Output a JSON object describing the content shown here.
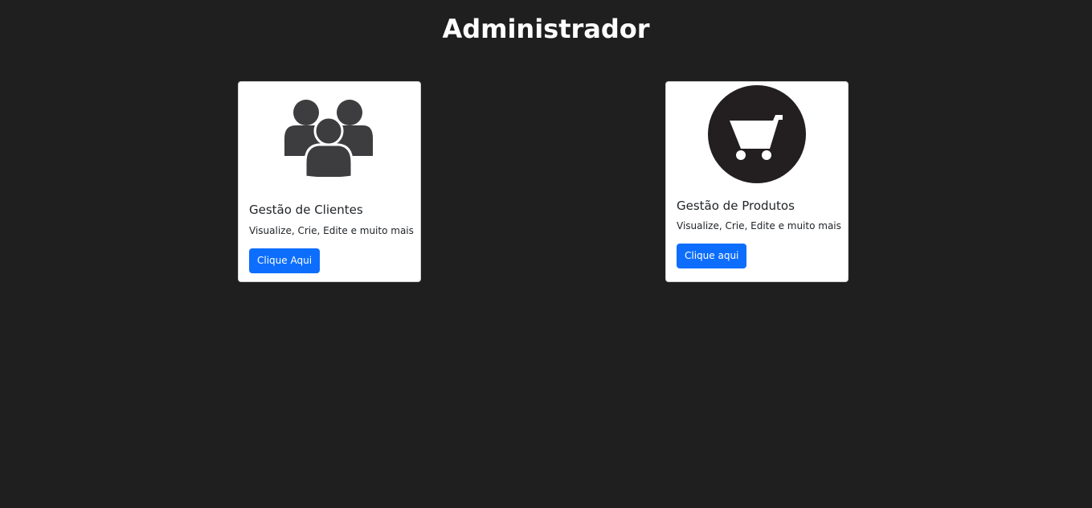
{
  "page": {
    "title": "Administrador",
    "background": "#1f1f1f"
  },
  "cards": [
    {
      "icon": "users-group-icon",
      "title": "Gestão de Clientes",
      "text": "Visualize, Crie, Edite e muito mais",
      "button_label": "Clique Aqui"
    },
    {
      "icon": "shopping-cart-icon",
      "title": "Gestão de Produtos",
      "text": "Visualize, Crie, Edite e muito mais",
      "button_label": "Clique aqui"
    }
  ],
  "colors": {
    "button": "#0d6efd",
    "icon_dark": "#3d3d3f",
    "cart_circle": "#231f20"
  }
}
